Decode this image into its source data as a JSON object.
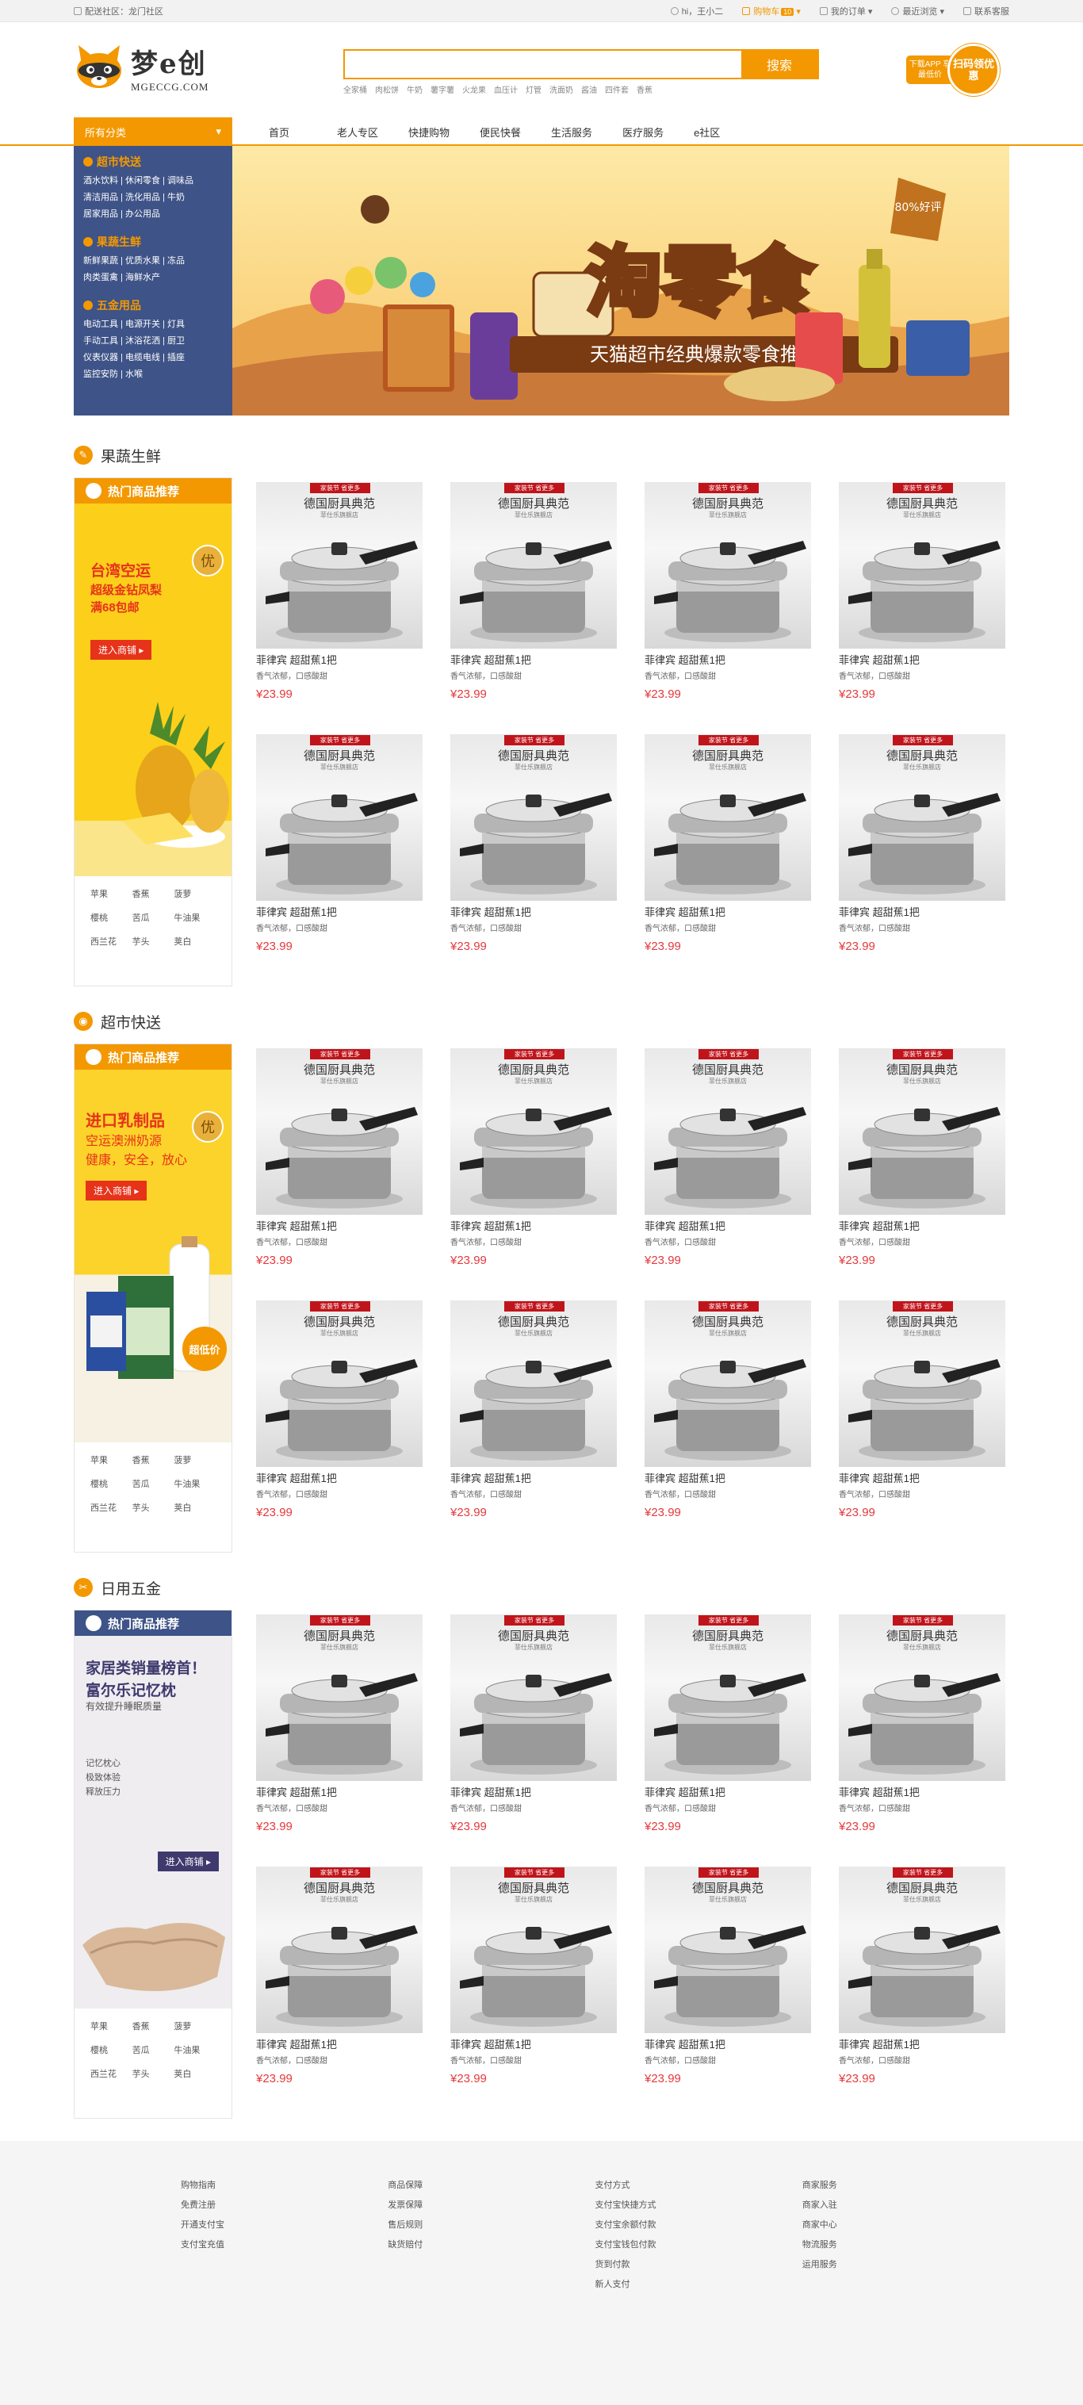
{
  "topbar": {
    "location": "配送社区：龙门社区",
    "user": "hi，王小二",
    "cart": "购物车",
    "cart_count": "10",
    "orders": "我的订单",
    "recent": "最近浏览",
    "service": "联系客服"
  },
  "logo": {
    "cn": "梦e创",
    "en": "MGECCG.COM"
  },
  "search": {
    "value": "",
    "placeholder": "",
    "button": "搜索",
    "hot": [
      "全家桶",
      "肉松饼",
      "牛奶",
      "薯字薯",
      "火龙果",
      "血压计",
      "灯管",
      "洗面奶",
      "酱油",
      "四件套",
      "香蕉"
    ]
  },
  "app": {
    "download": "下载APP 享最低价",
    "badge": "扫码领优惠"
  },
  "nav": {
    "all_categories": "所有分类",
    "items": [
      "首页",
      "老人专区",
      "快捷购物",
      "便民快餐",
      "生活服务",
      "医疗服务",
      "e社区"
    ]
  },
  "categories": [
    {
      "title": "超市快送",
      "links": [
        "酒水饮料 | 休闲零食 | 调味品",
        "清洁用品 | 洗化用品 | 牛奶",
        "居家用品 | 办公用品"
      ]
    },
    {
      "title": "果蔬生鲜",
      "links": [
        "新鲜果蔬 | 优质水果 | 冻品",
        "肉类蛋禽 | 海鲜水产"
      ]
    },
    {
      "title": "五金用品",
      "links": [
        "电动工具 | 电源开关 | 灯具",
        "手动工具 | 沐浴花洒 | 厨卫",
        "仪表仪器 | 电缆电线 | 插座",
        "监控安防 | 水喉"
      ]
    }
  ],
  "hero": {
    "title": "淘零食",
    "subtitle": "天猫超市经典爆款零食推荐",
    "sticker": "80%好评"
  },
  "sections": [
    {
      "title": "果蔬生鲜",
      "side_header": "热门商品推荐",
      "accent": "#f39800",
      "ad": {
        "line1": "台湾空运",
        "line2": "超级金钻凤梨",
        "line3": "满68包邮",
        "cta": "进入商铺",
        "stamp": "优"
      },
      "tags": [
        "苹果",
        "香蕉",
        "菠萝",
        "樱桃",
        "苦瓜",
        "牛油果",
        "西兰花",
        "芋头",
        "荚白"
      ]
    },
    {
      "title": "超市快送",
      "side_header": "热门商品推荐",
      "accent": "#f39800",
      "ad": {
        "line1": "进口乳制品",
        "line2": "空运澳洲奶源",
        "line3": "健康，安全，放心",
        "cta": "进入商铺",
        "stamp": "优",
        "badge": "超低价"
      },
      "tags": [
        "苹果",
        "香蕉",
        "菠萝",
        "樱桃",
        "苦瓜",
        "牛油果",
        "西兰花",
        "芋头",
        "荚白"
      ]
    },
    {
      "title": "日用五金",
      "side_header": "热门商品推荐",
      "accent": "#3e5387",
      "ad": {
        "line1": "家居类销量榜首！",
        "line2": "富尔乐记忆枕",
        "line3": "有效提升睡眠质量",
        "bullets": [
          "记忆枕心",
          "极致体验",
          "释放压力"
        ],
        "cta": "进入商铺"
      },
      "tags": [
        "苹果",
        "香蕉",
        "菠萝",
        "樱桃",
        "苦瓜",
        "牛油果",
        "西兰花",
        "芋头",
        "荚白"
      ]
    }
  ],
  "product": {
    "tag": "家装节 省更多",
    "brand": "德国厨具典范",
    "sub": "菲仕乐旗舰店",
    "name": "菲律宾 超甜蕉1把",
    "desc": "香气浓郁，口感酸甜",
    "price": "¥23.99"
  },
  "footer": [
    [
      "购物指南",
      "免费注册",
      "开通支付宝",
      "支付宝充值"
    ],
    [
      "商品保障",
      "发票保障",
      "售后规则",
      "缺货赔付"
    ],
    [
      "支付方式",
      "支付宝快捷方式",
      "支付宝余额付款",
      "支付宝钱包付款",
      "货到付款",
      "新人支付"
    ],
    [
      "商家服务",
      "商家入驻",
      "商家中心",
      "物流服务",
      "运用服务"
    ]
  ]
}
